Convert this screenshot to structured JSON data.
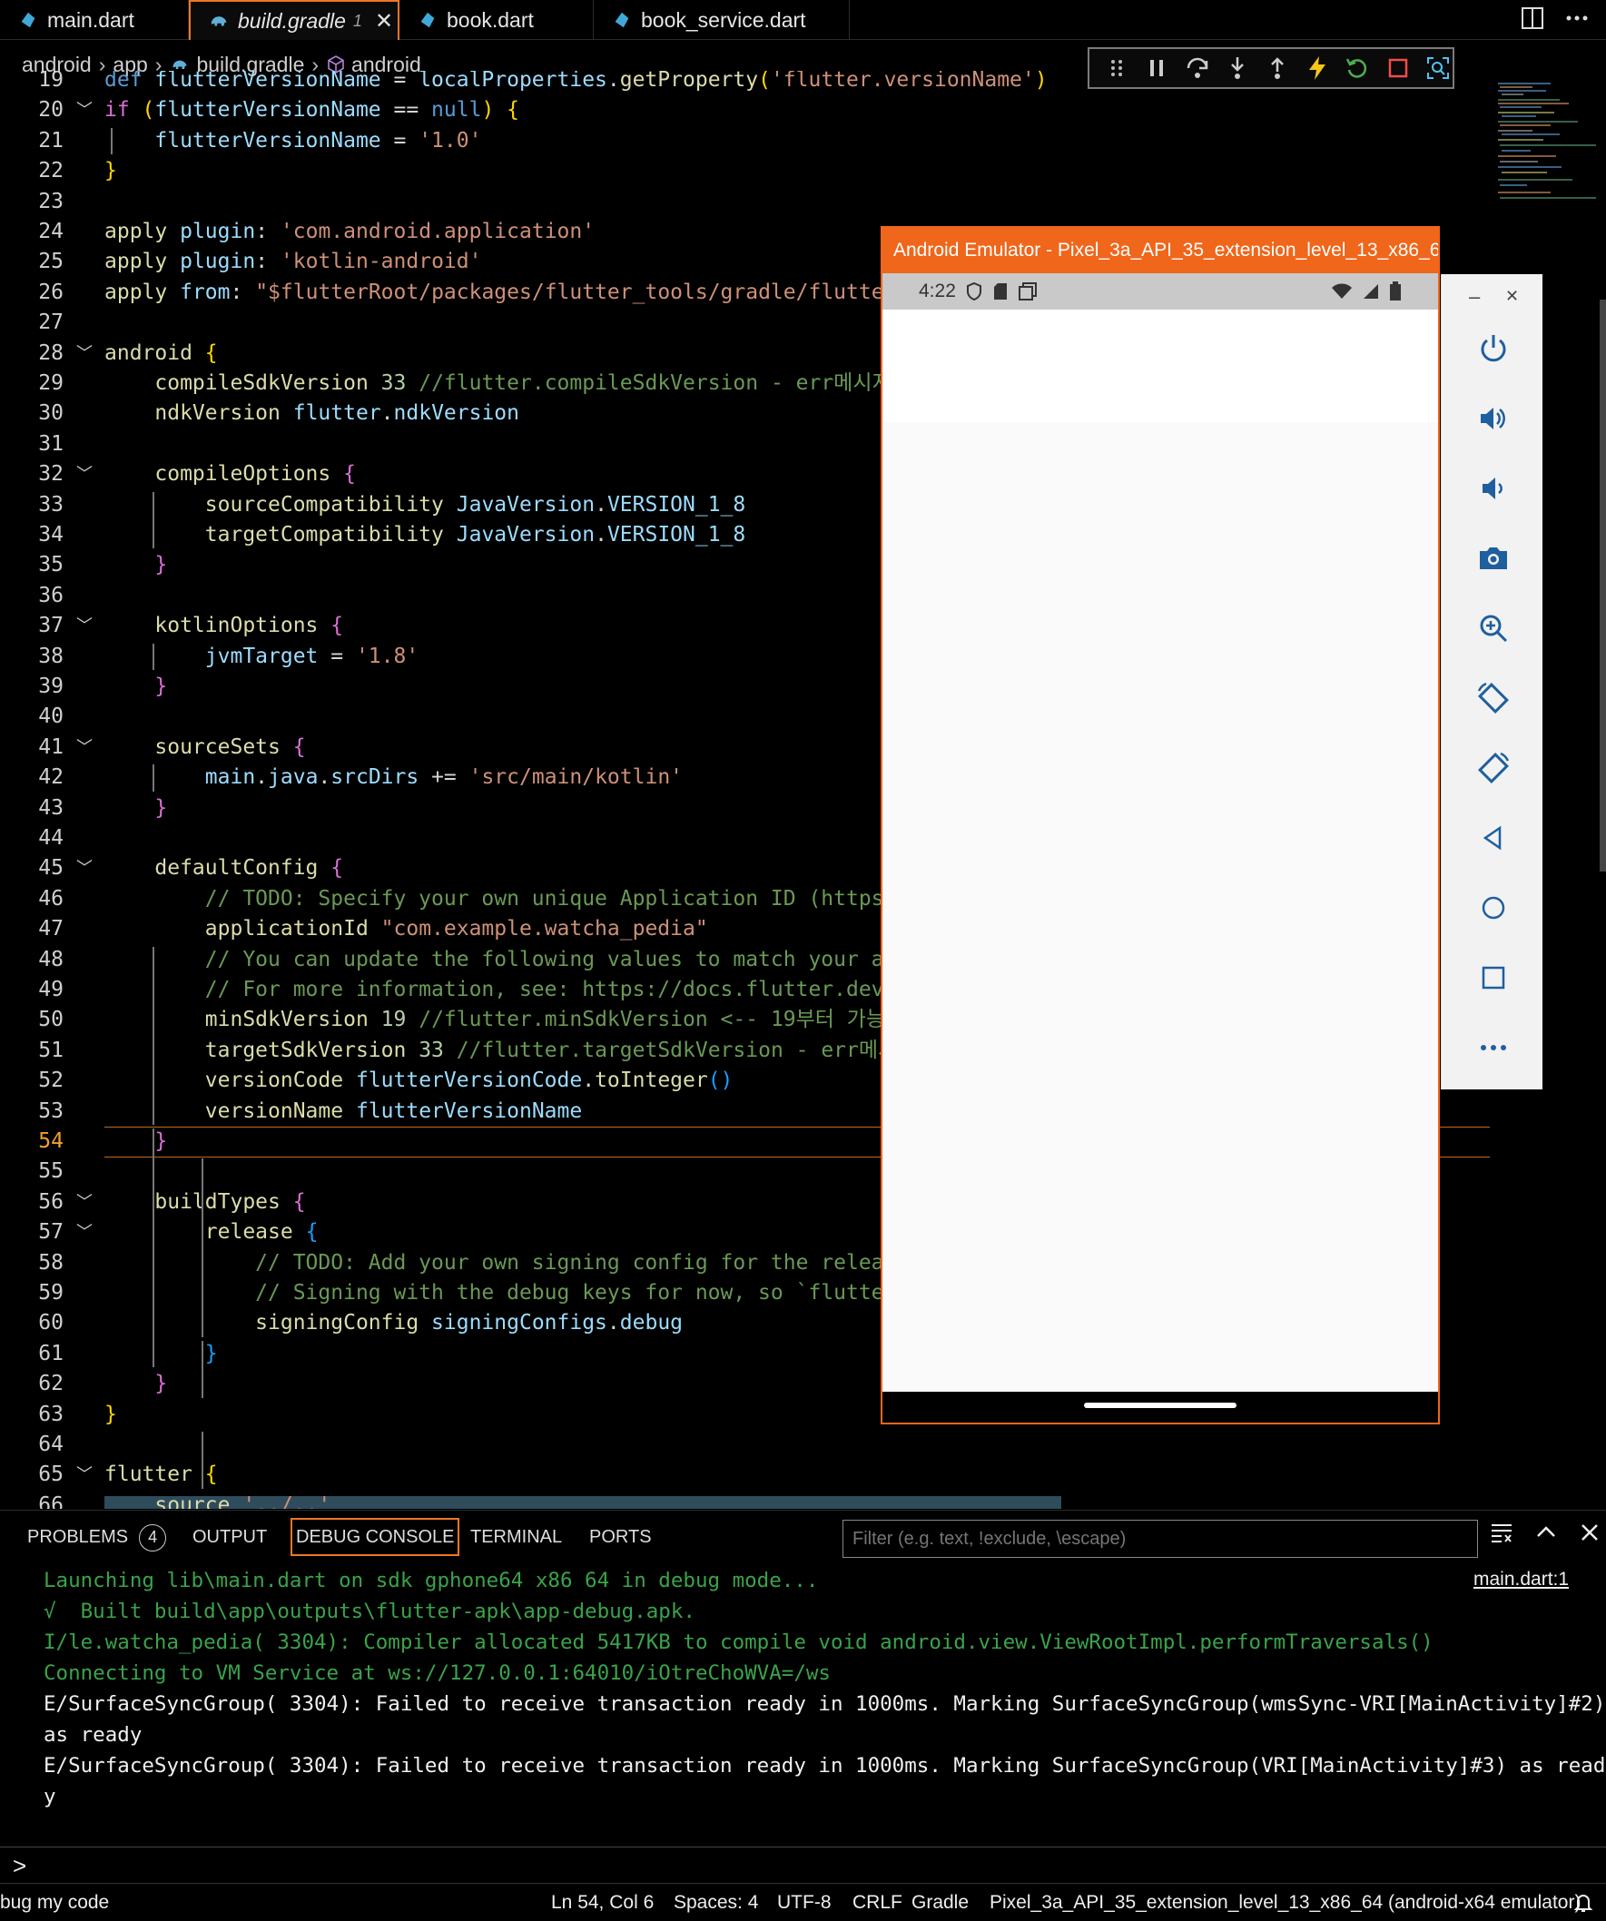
{
  "tabs": [
    {
      "label": "main.dart"
    },
    {
      "label": "build.gradle",
      "badge": "1",
      "close": "✕"
    },
    {
      "label": "book.dart"
    },
    {
      "label": "book_service.dart"
    }
  ],
  "breadcrumb": [
    "android",
    "app",
    "build.gradle",
    "android"
  ],
  "editor": {
    "lines": [
      {
        "n": "19",
        "code": [
          [
            "k",
            "def "
          ],
          [
            "v",
            "flutterVersionName"
          ],
          [
            "t",
            " = "
          ],
          [
            "v",
            "localProperties"
          ],
          [
            "t",
            "."
          ],
          [
            "f",
            "getProperty"
          ],
          [
            "y",
            "("
          ],
          [
            "s",
            "'flutter.versionName'"
          ],
          [
            "y",
            ")"
          ]
        ]
      },
      {
        "n": "20",
        "fold": "﹀",
        "code": [
          [
            "p",
            "if "
          ],
          [
            "y",
            "("
          ],
          [
            "v",
            "flutterVersionName"
          ],
          [
            "t",
            " == "
          ],
          [
            "k",
            "null"
          ],
          [
            "y",
            ")"
          ],
          [
            "t",
            " "
          ],
          [
            "y",
            "{"
          ]
        ]
      },
      {
        "n": "21",
        "code": [
          [
            "t",
            "    "
          ],
          [
            "v",
            "flutterVersionName"
          ],
          [
            "t",
            " = "
          ],
          [
            "s",
            "'1.0'"
          ]
        ]
      },
      {
        "n": "22",
        "code": [
          [
            "y",
            "}"
          ]
        ]
      },
      {
        "n": "23",
        "code": []
      },
      {
        "n": "24",
        "code": [
          [
            "f",
            "apply"
          ],
          [
            "t",
            " "
          ],
          [
            "v",
            "plugin"
          ],
          [
            "t",
            ": "
          ],
          [
            "s",
            "'com.android.application'"
          ]
        ]
      },
      {
        "n": "25",
        "code": [
          [
            "f",
            "apply"
          ],
          [
            "t",
            " "
          ],
          [
            "v",
            "plugin"
          ],
          [
            "t",
            ": "
          ],
          [
            "s",
            "'kotlin-android'"
          ]
        ]
      },
      {
        "n": "26",
        "code": [
          [
            "f",
            "apply"
          ],
          [
            "t",
            " "
          ],
          [
            "v",
            "from"
          ],
          [
            "t",
            ": "
          ],
          [
            "s",
            "\"$flutterRoot/packages/flutter_tools/gradle/flutter"
          ]
        ]
      },
      {
        "n": "27",
        "code": []
      },
      {
        "n": "28",
        "fold": "﹀",
        "code": [
          [
            "f",
            "android"
          ],
          [
            "t",
            " "
          ],
          [
            "y",
            "{"
          ]
        ]
      },
      {
        "n": "29",
        "code": [
          [
            "t",
            "    "
          ],
          [
            "f",
            "compileSdkVersion"
          ],
          [
            "t",
            " "
          ],
          [
            "n",
            "33"
          ],
          [
            "t",
            " "
          ],
          [
            "c",
            "//flutter.compileSdkVersion - err메시지"
          ]
        ]
      },
      {
        "n": "30",
        "code": [
          [
            "t",
            "    "
          ],
          [
            "f",
            "ndkVersion"
          ],
          [
            "t",
            " "
          ],
          [
            "v",
            "flutter"
          ],
          [
            "t",
            "."
          ],
          [
            "v",
            "ndkVersion"
          ]
        ]
      },
      {
        "n": "31",
        "code": []
      },
      {
        "n": "32",
        "fold": "﹀",
        "code": [
          [
            "t",
            "    "
          ],
          [
            "f",
            "compileOptions"
          ],
          [
            "t",
            " "
          ],
          [
            "p",
            "{"
          ]
        ]
      },
      {
        "n": "33",
        "code": [
          [
            "t",
            "        "
          ],
          [
            "f",
            "sourceCompatibility"
          ],
          [
            "t",
            " "
          ],
          [
            "v",
            "JavaVersion"
          ],
          [
            "t",
            "."
          ],
          [
            "v",
            "VERSION_1_8"
          ]
        ]
      },
      {
        "n": "34",
        "code": [
          [
            "t",
            "        "
          ],
          [
            "f",
            "targetCompatibility"
          ],
          [
            "t",
            " "
          ],
          [
            "v",
            "JavaVersion"
          ],
          [
            "t",
            "."
          ],
          [
            "v",
            "VERSION_1_8"
          ]
        ]
      },
      {
        "n": "35",
        "code": [
          [
            "t",
            "    "
          ],
          [
            "p",
            "}"
          ]
        ]
      },
      {
        "n": "36",
        "code": []
      },
      {
        "n": "37",
        "fold": "﹀",
        "code": [
          [
            "t",
            "    "
          ],
          [
            "f",
            "kotlinOptions"
          ],
          [
            "t",
            " "
          ],
          [
            "p",
            "{"
          ]
        ]
      },
      {
        "n": "38",
        "code": [
          [
            "t",
            "        "
          ],
          [
            "v",
            "jvmTarget"
          ],
          [
            "t",
            " = "
          ],
          [
            "s",
            "'1.8'"
          ]
        ]
      },
      {
        "n": "39",
        "code": [
          [
            "t",
            "    "
          ],
          [
            "p",
            "}"
          ]
        ]
      },
      {
        "n": "40",
        "code": []
      },
      {
        "n": "41",
        "fold": "﹀",
        "code": [
          [
            "t",
            "    "
          ],
          [
            "f",
            "sourceSets"
          ],
          [
            "t",
            " "
          ],
          [
            "p",
            "{"
          ]
        ]
      },
      {
        "n": "42",
        "code": [
          [
            "t",
            "        "
          ],
          [
            "v",
            "main"
          ],
          [
            "t",
            "."
          ],
          [
            "v",
            "java"
          ],
          [
            "t",
            "."
          ],
          [
            "v",
            "srcDirs"
          ],
          [
            "t",
            " += "
          ],
          [
            "s",
            "'src/main/kotlin'"
          ]
        ]
      },
      {
        "n": "43",
        "code": [
          [
            "t",
            "    "
          ],
          [
            "p",
            "}"
          ]
        ]
      },
      {
        "n": "44",
        "code": []
      },
      {
        "n": "45",
        "fold": "﹀",
        "code": [
          [
            "t",
            "    "
          ],
          [
            "f",
            "defaultConfig"
          ],
          [
            "t",
            " "
          ],
          [
            "p",
            "{"
          ]
        ]
      },
      {
        "n": "46",
        "code": [
          [
            "t",
            "        "
          ],
          [
            "c",
            "// TODO: Specify your own unique Application ID (https:/"
          ]
        ]
      },
      {
        "n": "47",
        "code": [
          [
            "t",
            "        "
          ],
          [
            "f",
            "applicationId"
          ],
          [
            "t",
            " "
          ],
          [
            "s",
            "\"com.example.watcha_pedia\""
          ]
        ]
      },
      {
        "n": "48",
        "code": [
          [
            "t",
            "        "
          ],
          [
            "c",
            "// You can update the following values to match your app"
          ]
        ]
      },
      {
        "n": "49",
        "code": [
          [
            "t",
            "        "
          ],
          [
            "c",
            "// For more information, see: https://docs.flutter.dev/d"
          ]
        ]
      },
      {
        "n": "50",
        "code": [
          [
            "t",
            "        "
          ],
          [
            "f",
            "minSdkVersion"
          ],
          [
            "t",
            " "
          ],
          [
            "n",
            "19"
          ],
          [
            "t",
            " "
          ],
          [
            "c",
            "//flutter.minSdkVersion <-- 19부터 가능"
          ]
        ]
      },
      {
        "n": "51",
        "code": [
          [
            "t",
            "        "
          ],
          [
            "f",
            "targetSdkVersion"
          ],
          [
            "t",
            " "
          ],
          [
            "n",
            "33"
          ],
          [
            "t",
            " "
          ],
          [
            "c",
            "//flutter.targetSdkVersion - err메시"
          ]
        ]
      },
      {
        "n": "52",
        "code": [
          [
            "t",
            "        "
          ],
          [
            "f",
            "versionCode"
          ],
          [
            "t",
            " "
          ],
          [
            "v",
            "flutterVersionCode"
          ],
          [
            "t",
            "."
          ],
          [
            "f",
            "toInteger"
          ],
          [
            "b2",
            "()"
          ]
        ]
      },
      {
        "n": "53",
        "code": [
          [
            "t",
            "        "
          ],
          [
            "f",
            "versionName"
          ],
          [
            "t",
            " "
          ],
          [
            "v",
            "flutterVersionName"
          ]
        ]
      },
      {
        "n": "54",
        "cur": true,
        "code": [
          [
            "t",
            "    "
          ],
          [
            "p",
            "}"
          ]
        ]
      },
      {
        "n": "55",
        "code": []
      },
      {
        "n": "56",
        "fold": "﹀",
        "code": [
          [
            "t",
            "    "
          ],
          [
            "f",
            "buildTypes"
          ],
          [
            "t",
            " "
          ],
          [
            "p",
            "{"
          ]
        ]
      },
      {
        "n": "57",
        "fold": "﹀",
        "code": [
          [
            "t",
            "        "
          ],
          [
            "f",
            "release"
          ],
          [
            "t",
            " "
          ],
          [
            "b2",
            "{"
          ]
        ]
      },
      {
        "n": "58",
        "code": [
          [
            "t",
            "            "
          ],
          [
            "c",
            "// TODO: Add your own signing config for the release"
          ]
        ]
      },
      {
        "n": "59",
        "code": [
          [
            "t",
            "            "
          ],
          [
            "c",
            "// Signing with the debug keys for now, so `flutter"
          ]
        ]
      },
      {
        "n": "60",
        "code": [
          [
            "t",
            "            "
          ],
          [
            "f",
            "signingConfig"
          ],
          [
            "t",
            " "
          ],
          [
            "v",
            "signingConfigs"
          ],
          [
            "t",
            "."
          ],
          [
            "v",
            "debug"
          ]
        ]
      },
      {
        "n": "61",
        "code": [
          [
            "t",
            "        "
          ],
          [
            "b2",
            "}"
          ]
        ]
      },
      {
        "n": "62",
        "code": [
          [
            "t",
            "    "
          ],
          [
            "p",
            "}"
          ]
        ]
      },
      {
        "n": "63",
        "code": [
          [
            "y",
            "}"
          ]
        ]
      },
      {
        "n": "64",
        "code": []
      },
      {
        "n": "65",
        "fold": "﹀",
        "code": [
          [
            "f",
            "flutter"
          ],
          [
            "t",
            " "
          ],
          [
            "y",
            "{"
          ]
        ]
      },
      {
        "n": "66",
        "code": [
          [
            "t",
            "    "
          ],
          [
            "f",
            "source"
          ],
          [
            "t",
            " "
          ],
          [
            "s",
            "'../..'"
          ]
        ]
      }
    ]
  },
  "emulator": {
    "title": "Android Emulator - Pixel_3a_API_35_extension_level_13_x86_6...",
    "time": "4:22",
    "window_min": "–",
    "window_close": "✕"
  },
  "panel": {
    "tabs": [
      {
        "label": "PROBLEMS",
        "badge": "4"
      },
      {
        "label": "OUTPUT"
      },
      {
        "label": "DEBUG CONSOLE",
        "active": true
      },
      {
        "label": "TERMINAL"
      },
      {
        "label": "PORTS"
      }
    ],
    "filter_placeholder": "Filter (e.g. text, !exclude, \\escape)",
    "source_link": "main.dart:1",
    "output": [
      {
        "cls": "g",
        "text": "Launching lib\\main.dart on sdk gphone64 x86 64 in debug mode..."
      },
      {
        "cls": "g",
        "text": "√  Built build\\app\\outputs\\flutter-apk\\app-debug.apk."
      },
      {
        "cls": "g",
        "text": "I/le.watcha_pedia( 3304): Compiler allocated 5417KB to compile void android.view.ViewRootImpl.performTraversals()"
      },
      {
        "cls": "g",
        "text": "Connecting to VM Service at ws://127.0.0.1:64010/iOtreChoWVA=/ws"
      },
      {
        "cls": "w",
        "text": "E/SurfaceSyncGroup( 3304): Failed to receive transaction ready in 1000ms. Marking SurfaceSyncGroup(wmsSync-VRI[MainActivity]#2)"
      },
      {
        "cls": "w",
        "text": "as ready"
      },
      {
        "cls": "w",
        "text": "E/SurfaceSyncGroup( 3304): Failed to receive transaction ready in 1000ms. Marking SurfaceSyncGroup(VRI[MainActivity]#3) as read"
      },
      {
        "cls": "w",
        "text": "y"
      }
    ],
    "prompt": ">"
  },
  "statusbar": {
    "left": "bug my code",
    "position": "Ln 54, Col 6",
    "spaces": "Spaces: 4",
    "encoding": "UTF-8",
    "eol": "CRLF",
    "language": "Gradle",
    "device": "Pixel_3a_API_35_extension_level_13_x86_64 (android-x64 emulator)"
  },
  "colors": {
    "accent": "#f07624",
    "emulator_title": "#f0661a"
  }
}
